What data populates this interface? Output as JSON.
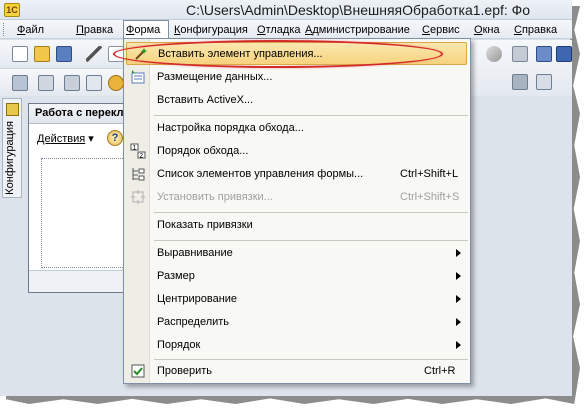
{
  "window": {
    "title": "C:\\Users\\Admin\\Desktop\\ВнешняяОбработка1.epf: Фо",
    "app_icon": "1c-logo-icon"
  },
  "menubar": {
    "items": [
      {
        "label": "Файл",
        "underline": "Ф"
      },
      {
        "label": "Правка",
        "underline": "П"
      },
      {
        "label": "Форма",
        "underline": "Ф",
        "active": true
      },
      {
        "label": "Конфигурация",
        "underline": "К"
      },
      {
        "label": "Отладка",
        "underline": "О"
      },
      {
        "label": "Администрирование",
        "underline": "А"
      },
      {
        "label": "Сервис",
        "underline": "С"
      },
      {
        "label": "Окна",
        "underline": "О"
      },
      {
        "label": "Справка",
        "underline": "С"
      }
    ]
  },
  "side_panel": {
    "label": "Конфигурация"
  },
  "form_window": {
    "title": "Работа с переключателем",
    "actions_label": "Действия",
    "help_label": "?"
  },
  "dropdown": {
    "items": [
      {
        "label": "Вставить элемент управления...",
        "icon": "insert-control-icon",
        "highlight": true
      },
      {
        "label": "Размещение данных...",
        "icon": "data-placement-icon"
      },
      {
        "label": "Вставить ActiveX..."
      },
      {
        "separator": true
      },
      {
        "label": "Настройка порядка обхода..."
      },
      {
        "label": "Порядок обхода...",
        "icon": "tab-order-icon"
      },
      {
        "label": "Список элементов управления формы...",
        "icon": "control-list-icon",
        "shortcut": "Ctrl+Shift+L"
      },
      {
        "label": "Установить привязки...",
        "icon": "bindings-icon",
        "shortcut": "Ctrl+Shift+S",
        "disabled": true
      },
      {
        "separator": true
      },
      {
        "label": "Показать привязки"
      },
      {
        "separator": true
      },
      {
        "label": "Выравнивание",
        "submenu": true
      },
      {
        "label": "Размер",
        "submenu": true
      },
      {
        "label": "Центрирование",
        "submenu": true
      },
      {
        "label": "Распределить",
        "submenu": true
      },
      {
        "label": "Порядок",
        "submenu": true
      },
      {
        "separator": true
      },
      {
        "label": "Проверить",
        "icon": "check-icon",
        "shortcut": "Ctrl+R"
      }
    ]
  },
  "colors": {
    "highlight": "#f7d37e",
    "annotation_oval": "#d42a2a"
  }
}
